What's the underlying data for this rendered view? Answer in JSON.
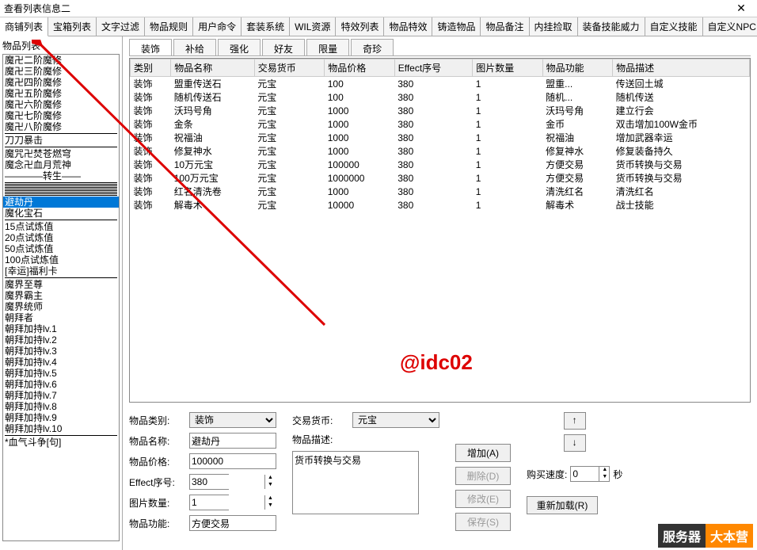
{
  "window": {
    "title": "查看列表信息二"
  },
  "main_tabs": [
    "商铺列表",
    "宝箱列表",
    "文字过滤",
    "物品规则",
    "用户命令",
    "套装系统",
    "WIL资源",
    "特效列表",
    "物品特效",
    "铸造物品",
    "物品备注",
    "内挂捡取",
    "装备技能威力",
    "自定义技能",
    "自定义NPC"
  ],
  "active_main_tab": 0,
  "left_panel": {
    "label": "物品列表",
    "groups": [
      [
        "魔卍二阶魔修",
        "魔卍三阶魔修",
        "魔卍四阶魔修",
        "魔卍五阶魔修",
        "魔卍六阶魔修",
        "魔卍七阶魔修",
        "魔卍八阶魔修"
      ],
      [
        "刀刀暴击"
      ],
      [
        "魔咒卍焚苍燃穹",
        "魔念卍血月荒神",
        "————转生——"
      ],
      [],
      [],
      [],
      [],
      [],
      [],
      [],
      [],
      [
        "避劫丹",
        "魔化宝石"
      ],
      [
        "15点试炼值",
        "20点试炼值",
        "50点试炼值",
        "100点试炼值",
        "[幸运]福利卡"
      ],
      [
        "魔界至尊",
        "魔界霸主",
        "魔界统师",
        "朝拜者",
        "朝拜加持lv.1",
        "朝拜加持lv.2",
        "朝拜加持lv.3",
        "朝拜加持lv.4",
        "朝拜加持lv.5",
        "朝拜加持lv.6",
        "朝拜加持lv.7",
        "朝拜加持lv.8",
        "朝拜加持lv.9",
        "朝拜加持lv.10"
      ],
      [
        "*血气斗争[句]"
      ]
    ],
    "selected": "避劫丹"
  },
  "sub_tabs": [
    "装饰",
    "补给",
    "强化",
    "好友",
    "限量",
    "奇珍"
  ],
  "active_sub_tab": 0,
  "table": {
    "headers": [
      "类别",
      "物品名称",
      "交易货币",
      "物品价格",
      "Effect序号",
      "图片数量",
      "物品功能",
      "物品描述"
    ],
    "rows": [
      [
        "装饰",
        "盟重传送石",
        "元宝",
        "100",
        "380",
        "1",
        "盟重...",
        "传送回土城"
      ],
      [
        "装饰",
        "随机传送石",
        "元宝",
        "100",
        "380",
        "1",
        "随机...",
        "随机传送"
      ],
      [
        "装饰",
        "沃玛号角",
        "元宝",
        "1000",
        "380",
        "1",
        "沃玛号角",
        "建立行会"
      ],
      [
        "装饰",
        "金条",
        "元宝",
        "1000",
        "380",
        "1",
        "金币",
        "双击增加100W金币"
      ],
      [
        "装饰",
        "祝福油",
        "元宝",
        "1000",
        "380",
        "1",
        "祝福油",
        "增加武器幸运"
      ],
      [
        "装饰",
        "修复神水",
        "元宝",
        "1000",
        "380",
        "1",
        "修复神水",
        "修复装备持久"
      ],
      [
        "装饰",
        "10万元宝",
        "元宝",
        "100000",
        "380",
        "1",
        "方便交易",
        "货币转换与交易"
      ],
      [
        "装饰",
        "100万元宝",
        "元宝",
        "1000000",
        "380",
        "1",
        "方便交易",
        "货币转换与交易"
      ],
      [
        "装饰",
        "红名清洗卷",
        "元宝",
        "1000",
        "380",
        "1",
        "清洗红名",
        "清洗红名"
      ],
      [
        "装饰",
        "解毒术",
        "元宝",
        "10000",
        "380",
        "1",
        "解毒术",
        "战士技能"
      ]
    ]
  },
  "form": {
    "item_category_label": "物品类别:",
    "item_category_value": "装饰",
    "item_name_label": "物品名称:",
    "item_name_value": "避劫丹",
    "item_price_label": "物品价格:",
    "item_price_value": "100000",
    "effect_label": "Effect序号:",
    "effect_value": "380",
    "img_count_label": "图片数量:",
    "img_count_value": "1",
    "item_func_label": "物品功能:",
    "item_func_value": "方便交易",
    "currency_label": "交易货币:",
    "currency_value": "元宝",
    "desc_label": "物品描述:",
    "desc_value": "货币转换与交易",
    "btn_add": "增加(A)",
    "btn_del": "删除(D)",
    "btn_mod": "修改(E)",
    "btn_save": "保存(S)",
    "speed_label": "购买速度:",
    "speed_value": "0",
    "speed_unit": "秒",
    "reload": "重新加载(R)"
  },
  "watermark": "@idc02",
  "footer": {
    "s1": "服务器",
    "s2": "大本营"
  }
}
